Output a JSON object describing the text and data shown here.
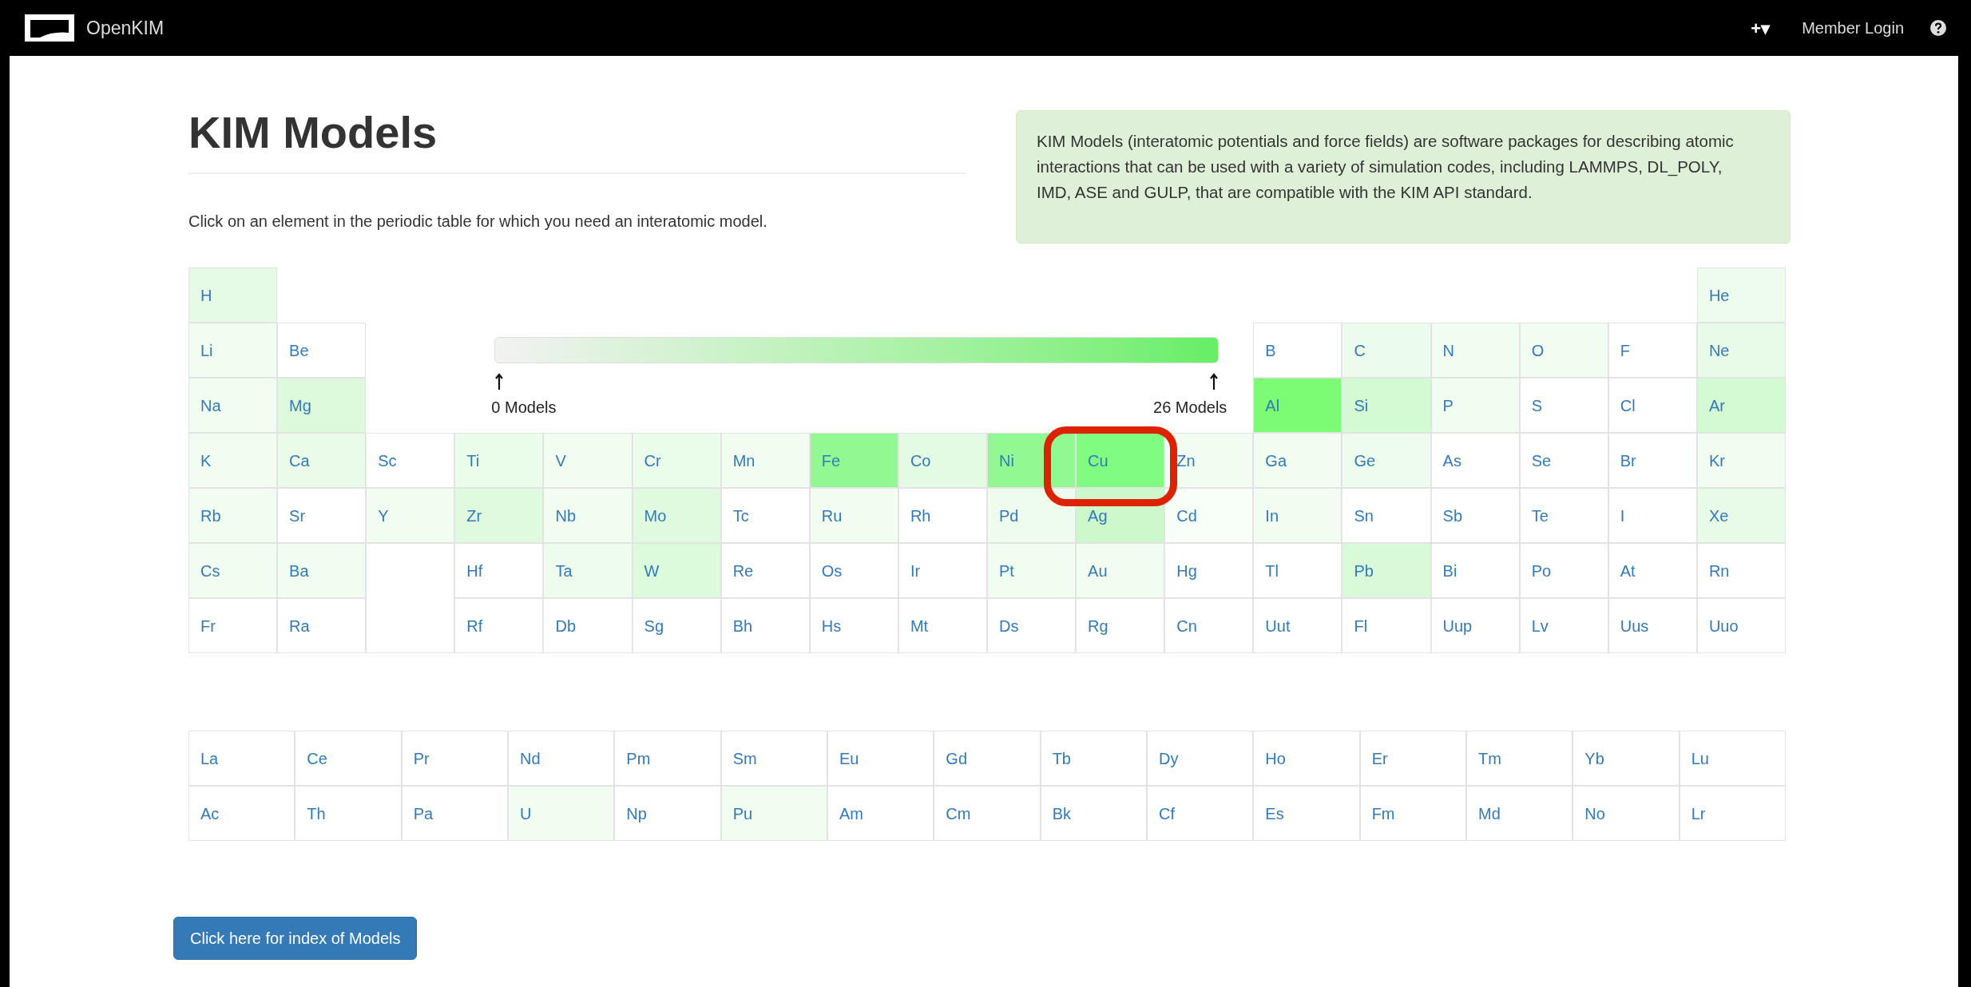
{
  "navbar": {
    "brand": "OpenKIM",
    "add_menu": "+▾",
    "login": "Member Login"
  },
  "title": "KIM Models",
  "intro": "Click on an element in the periodic table for which you need an interatomic model.",
  "info": "KIM Models (interatomic potentials and force fields) are software packages for describing atomic interactions that can be used with a variety of simulation codes, including LAMMPS, DL_POLY, IMD, ASE and GULP, that are compatible with the KIM API standard.",
  "legend": {
    "min_label": "0 Models",
    "max_label": "26 Models"
  },
  "periodic_rows": [
    [
      {
        "symbol": "H",
        "color": "#e6fbe6",
        "circled": false
      },
      {
        "symbol": "He",
        "color": "#eefcee",
        "circled": false
      }
    ],
    [
      {
        "symbol": "Li",
        "color": "#f2fdf2",
        "circled": false
      },
      {
        "symbol": "Be",
        "color": "#ffffff",
        "circled": false
      },
      {
        "symbol": "B",
        "color": "#ffffff",
        "circled": false
      },
      {
        "symbol": "C",
        "color": "#ecfcec",
        "circled": false
      },
      {
        "symbol": "N",
        "color": "#f2fdf2",
        "circled": false
      },
      {
        "symbol": "O",
        "color": "#f2fdf2",
        "circled": false
      },
      {
        "symbol": "F",
        "color": "#ffffff",
        "circled": false
      },
      {
        "symbol": "Ne",
        "color": "#e8fbe8",
        "circled": false
      }
    ],
    [
      {
        "symbol": "Na",
        "color": "#f2fdf2",
        "circled": false
      },
      {
        "symbol": "Mg",
        "color": "#ddfadd",
        "circled": false
      },
      {
        "symbol": "Al",
        "color": "#7cfc74",
        "circled": false
      },
      {
        "symbol": "Si",
        "color": "#d4fad4",
        "circled": false
      },
      {
        "symbol": "P",
        "color": "#f2fdf2",
        "circled": false
      },
      {
        "symbol": "S",
        "color": "#ffffff",
        "circled": false
      },
      {
        "symbol": "Cl",
        "color": "#ffffff",
        "circled": false
      },
      {
        "symbol": "Ar",
        "color": "#d4fad4",
        "circled": false
      }
    ],
    [
      {
        "symbol": "K",
        "color": "#f2fdf2",
        "circled": false
      },
      {
        "symbol": "Ca",
        "color": "#eafbea",
        "circled": false
      },
      {
        "symbol": "Sc",
        "color": "#ffffff",
        "circled": false
      },
      {
        "symbol": "Ti",
        "color": "#eafcea",
        "circled": false
      },
      {
        "symbol": "V",
        "color": "#f2fdf2",
        "circled": false
      },
      {
        "symbol": "Cr",
        "color": "#eafcea",
        "circled": false
      },
      {
        "symbol": "Mn",
        "color": "#f2fdf2",
        "circled": false
      },
      {
        "symbol": "Fe",
        "color": "#92f892",
        "circled": false
      },
      {
        "symbol": "Co",
        "color": "#e2fbe2",
        "circled": false
      },
      {
        "symbol": "Ni",
        "color": "#92f892",
        "circled": false
      },
      {
        "symbol": "Cu",
        "color": "#80fc80",
        "circled": true
      },
      {
        "symbol": "Zn",
        "color": "#f2fdf2",
        "circled": false
      },
      {
        "symbol": "Ga",
        "color": "#f2fdf2",
        "circled": false
      },
      {
        "symbol": "Ge",
        "color": "#eefcee",
        "circled": false
      },
      {
        "symbol": "As",
        "color": "#ffffff",
        "circled": false
      },
      {
        "symbol": "Se",
        "color": "#ffffff",
        "circled": false
      },
      {
        "symbol": "Br",
        "color": "#ffffff",
        "circled": false
      },
      {
        "symbol": "Kr",
        "color": "#f2fdf2",
        "circled": false
      }
    ],
    [
      {
        "symbol": "Rb",
        "color": "#f2fdf2",
        "circled": false
      },
      {
        "symbol": "Sr",
        "color": "#ffffff",
        "circled": false
      },
      {
        "symbol": "Y",
        "color": "#f2fdf2",
        "circled": false
      },
      {
        "symbol": "Zr",
        "color": "#e0fae0",
        "circled": false
      },
      {
        "symbol": "Nb",
        "color": "#f2fdf2",
        "circled": false
      },
      {
        "symbol": "Mo",
        "color": "#e0fae0",
        "circled": false
      },
      {
        "symbol": "Tc",
        "color": "#ffffff",
        "circled": false
      },
      {
        "symbol": "Ru",
        "color": "#f2fdf2",
        "circled": false
      },
      {
        "symbol": "Rh",
        "color": "#ffffff",
        "circled": false
      },
      {
        "symbol": "Pd",
        "color": "#eefcee",
        "circled": false
      },
      {
        "symbol": "Ag",
        "color": "#ccf8cc",
        "circled": false
      },
      {
        "symbol": "Cd",
        "color": "#f8fef8",
        "circled": false
      },
      {
        "symbol": "In",
        "color": "#f2fdf2",
        "circled": false
      },
      {
        "symbol": "Sn",
        "color": "#ffffff",
        "circled": false
      },
      {
        "symbol": "Sb",
        "color": "#ffffff",
        "circled": false
      },
      {
        "symbol": "Te",
        "color": "#ffffff",
        "circled": false
      },
      {
        "symbol": "I",
        "color": "#ffffff",
        "circled": false
      },
      {
        "symbol": "Xe",
        "color": "#e8fbe8",
        "circled": false
      }
    ],
    [
      {
        "symbol": "Cs",
        "color": "#f2fdf2",
        "circled": false
      },
      {
        "symbol": "Ba",
        "color": "#f2fdf2",
        "circled": false
      },
      {
        "symbol": "Hf",
        "color": "#ffffff",
        "circled": false
      },
      {
        "symbol": "Ta",
        "color": "#eefcee",
        "circled": false
      },
      {
        "symbol": "W",
        "color": "#dcfadc",
        "circled": false
      },
      {
        "symbol": "Re",
        "color": "#ffffff",
        "circled": false
      },
      {
        "symbol": "Os",
        "color": "#ffffff",
        "circled": false
      },
      {
        "symbol": "Ir",
        "color": "#ffffff",
        "circled": false
      },
      {
        "symbol": "Pt",
        "color": "#f2fdf2",
        "circled": false
      },
      {
        "symbol": "Au",
        "color": "#f2fdf2",
        "circled": false
      },
      {
        "symbol": "Hg",
        "color": "#ffffff",
        "circled": false
      },
      {
        "symbol": "Tl",
        "color": "#ffffff",
        "circled": false
      },
      {
        "symbol": "Pb",
        "color": "#d8fad8",
        "circled": false
      },
      {
        "symbol": "Bi",
        "color": "#ffffff",
        "circled": false
      },
      {
        "symbol": "Po",
        "color": "#ffffff",
        "circled": false
      },
      {
        "symbol": "At",
        "color": "#ffffff",
        "circled": false
      },
      {
        "symbol": "Rn",
        "color": "#ffffff",
        "circled": false
      }
    ],
    [
      {
        "symbol": "Fr",
        "color": "#ffffff",
        "circled": false
      },
      {
        "symbol": "Ra",
        "color": "#ffffff",
        "circled": false
      },
      {
        "symbol": "Rf",
        "color": "#ffffff",
        "circled": false
      },
      {
        "symbol": "Db",
        "color": "#ffffff",
        "circled": false
      },
      {
        "symbol": "Sg",
        "color": "#ffffff",
        "circled": false
      },
      {
        "symbol": "Bh",
        "color": "#ffffff",
        "circled": false
      },
      {
        "symbol": "Hs",
        "color": "#ffffff",
        "circled": false
      },
      {
        "symbol": "Mt",
        "color": "#ffffff",
        "circled": false
      },
      {
        "symbol": "Ds",
        "color": "#ffffff",
        "circled": false
      },
      {
        "symbol": "Rg",
        "color": "#ffffff",
        "circled": false
      },
      {
        "symbol": "Cn",
        "color": "#ffffff",
        "circled": false
      },
      {
        "symbol": "Uut",
        "color": "#ffffff",
        "circled": false
      },
      {
        "symbol": "Fl",
        "color": "#ffffff",
        "circled": false
      },
      {
        "symbol": "Uup",
        "color": "#ffffff",
        "circled": false
      },
      {
        "symbol": "Lv",
        "color": "#ffffff",
        "circled": false
      },
      {
        "symbol": "Uus",
        "color": "#ffffff",
        "circled": false
      },
      {
        "symbol": "Uuo",
        "color": "#ffffff",
        "circled": false
      }
    ]
  ],
  "f_block_rows": [
    [
      {
        "symbol": "La",
        "color": "#ffffff"
      },
      {
        "symbol": "Ce",
        "color": "#ffffff"
      },
      {
        "symbol": "Pr",
        "color": "#ffffff"
      },
      {
        "symbol": "Nd",
        "color": "#ffffff"
      },
      {
        "symbol": "Pm",
        "color": "#ffffff"
      },
      {
        "symbol": "Sm",
        "color": "#ffffff"
      },
      {
        "symbol": "Eu",
        "color": "#ffffff"
      },
      {
        "symbol": "Gd",
        "color": "#ffffff"
      },
      {
        "symbol": "Tb",
        "color": "#ffffff"
      },
      {
        "symbol": "Dy",
        "color": "#ffffff"
      },
      {
        "symbol": "Ho",
        "color": "#ffffff"
      },
      {
        "symbol": "Er",
        "color": "#ffffff"
      },
      {
        "symbol": "Tm",
        "color": "#ffffff"
      },
      {
        "symbol": "Yb",
        "color": "#ffffff"
      },
      {
        "symbol": "Lu",
        "color": "#ffffff"
      }
    ],
    [
      {
        "symbol": "Ac",
        "color": "#ffffff"
      },
      {
        "symbol": "Th",
        "color": "#ffffff"
      },
      {
        "symbol": "Pa",
        "color": "#ffffff"
      },
      {
        "symbol": "U",
        "color": "#f0fdf0"
      },
      {
        "symbol": "Np",
        "color": "#ffffff"
      },
      {
        "symbol": "Pu",
        "color": "#f0fdf0"
      },
      {
        "symbol": "Am",
        "color": "#ffffff"
      },
      {
        "symbol": "Cm",
        "color": "#ffffff"
      },
      {
        "symbol": "Bk",
        "color": "#ffffff"
      },
      {
        "symbol": "Cf",
        "color": "#ffffff"
      },
      {
        "symbol": "Es",
        "color": "#ffffff"
      },
      {
        "symbol": "Fm",
        "color": "#ffffff"
      },
      {
        "symbol": "Md",
        "color": "#ffffff"
      },
      {
        "symbol": "No",
        "color": "#ffffff"
      },
      {
        "symbol": "Lr",
        "color": "#ffffff"
      }
    ]
  ],
  "index_button": "Click here for index of Models"
}
